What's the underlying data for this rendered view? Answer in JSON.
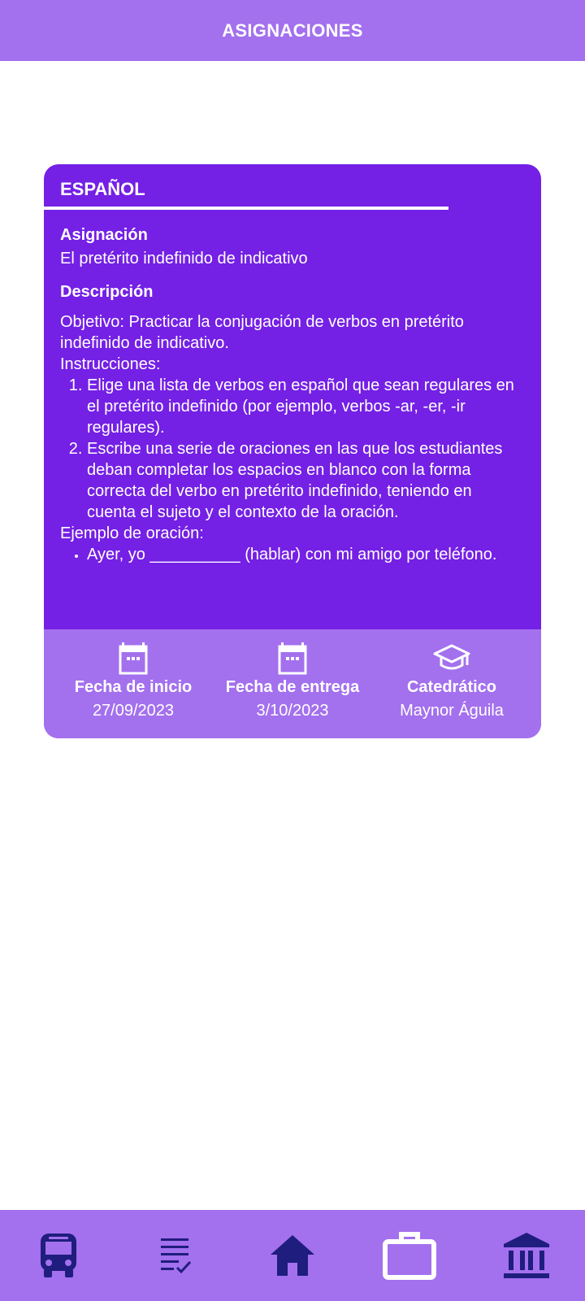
{
  "header": {
    "title": "ASIGNACIONES"
  },
  "card": {
    "subject": "ESPAÑOL",
    "assignment_label": "Asignación",
    "assignment_value": "El pretérito indefinido de indicativo",
    "description_label": "Descripción",
    "objective": "Objetivo: Practicar la conjugación de verbos en pretérito indefinido de indicativo.",
    "instructions_label": "Instrucciones:",
    "instructions": [
      "Elige una lista de verbos en español que sean regulares en el pretérito indefinido (por ejemplo, verbos -ar, -er, -ir regulares).",
      "Escribe una serie de oraciones en las que los estudiantes deban completar los espacios en blanco con la forma correcta del verbo en pretérito indefinido, teniendo en cuenta el sujeto y el contexto de la oración."
    ],
    "example_label": "Ejemplo de oración:",
    "example": "Ayer, yo __________ (hablar) con mi amigo por teléfono.",
    "meta": [
      {
        "title": "Fecha de inicio",
        "value": "27/09/2023",
        "icon": "calendar-icon"
      },
      {
        "title": "Fecha de entrega",
        "value": "3/10/2023",
        "icon": "calendar-icon"
      },
      {
        "title": "Catedrático",
        "value": "Maynor Águila",
        "icon": "graduation-cap-icon"
      }
    ]
  },
  "nav": {
    "items": [
      {
        "icon": "bus-icon"
      },
      {
        "icon": "checklist-icon"
      },
      {
        "icon": "home-icon"
      },
      {
        "icon": "briefcase-icon"
      },
      {
        "icon": "bank-icon"
      }
    ]
  },
  "colors": {
    "header_bg": "#a370ee",
    "card_bg": "#7420e5",
    "card_footer_bg": "#a370ee",
    "nav_icon": "#1f1d7e"
  }
}
